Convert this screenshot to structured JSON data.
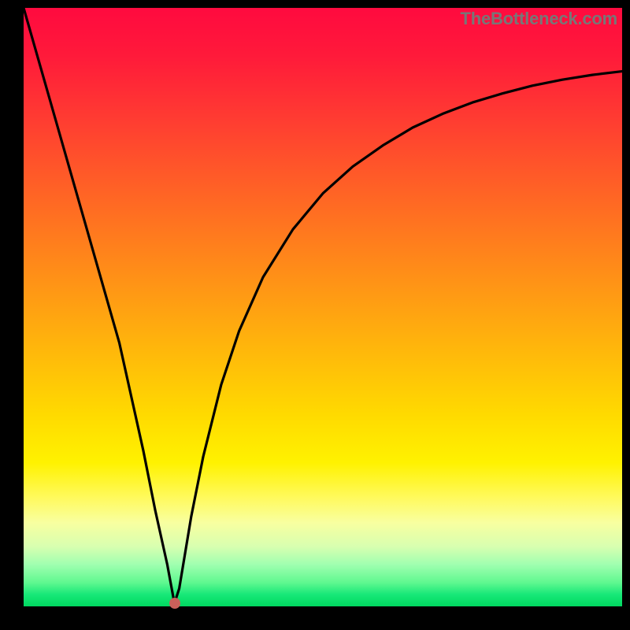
{
  "watermark": "TheBottleneck.com",
  "chart_data": {
    "type": "line",
    "title": "",
    "xlabel": "",
    "ylabel": "",
    "xlim": [
      0,
      100
    ],
    "ylim": [
      0,
      100
    ],
    "series": [
      {
        "name": "curve",
        "x": [
          0,
          4,
          8,
          12,
          16,
          20,
          22,
          24,
          25.2,
          26,
          27,
          28,
          30,
          33,
          36,
          40,
          45,
          50,
          55,
          60,
          65,
          70,
          75,
          80,
          85,
          90,
          95,
          100
        ],
        "y": [
          100,
          86,
          72,
          58,
          44,
          26,
          16,
          7,
          0.5,
          3,
          9,
          15,
          25,
          37,
          46,
          55,
          63,
          69,
          73.5,
          77,
          80,
          82.3,
          84.2,
          85.7,
          87,
          88,
          88.8,
          89.4
        ]
      }
    ],
    "marker": {
      "x": 25.2,
      "y": 0.5
    },
    "background_gradient": {
      "top": "#ff0a3f",
      "bottom": "#00d860"
    }
  }
}
